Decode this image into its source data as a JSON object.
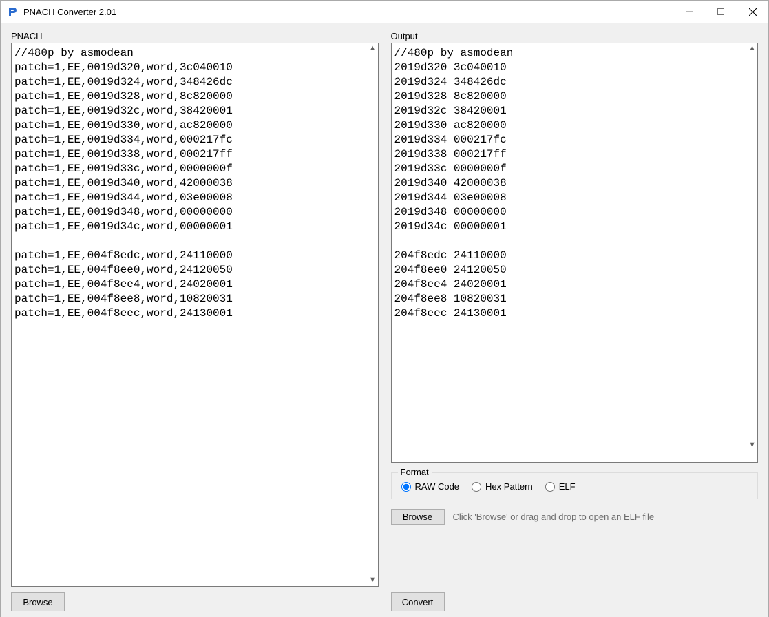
{
  "window": {
    "title": "PNACH Converter 2.01"
  },
  "labels": {
    "pnach": "PNACH",
    "output": "Output",
    "format_legend": "Format"
  },
  "radios": {
    "raw": "RAW Code",
    "hex": "Hex Pattern",
    "elf": "ELF"
  },
  "buttons": {
    "browse": "Browse",
    "convert": "Convert"
  },
  "hint": {
    "elf": "Click 'Browse' or drag and drop to open an ELF file"
  },
  "input_text": "//480p by asmodean\npatch=1,EE,0019d320,word,3c040010\npatch=1,EE,0019d324,word,348426dc\npatch=1,EE,0019d328,word,8c820000\npatch=1,EE,0019d32c,word,38420001\npatch=1,EE,0019d330,word,ac820000\npatch=1,EE,0019d334,word,000217fc\npatch=1,EE,0019d338,word,000217ff\npatch=1,EE,0019d33c,word,0000000f\npatch=1,EE,0019d340,word,42000038\npatch=1,EE,0019d344,word,03e00008\npatch=1,EE,0019d348,word,00000000\npatch=1,EE,0019d34c,word,00000001\n\npatch=1,EE,004f8edc,word,24110000\npatch=1,EE,004f8ee0,word,24120050\npatch=1,EE,004f8ee4,word,24020001\npatch=1,EE,004f8ee8,word,10820031\npatch=1,EE,004f8eec,word,24130001",
  "output_text": "//480p by asmodean\n2019d320 3c040010\n2019d324 348426dc\n2019d328 8c820000\n2019d32c 38420001\n2019d330 ac820000\n2019d334 000217fc\n2019d338 000217ff\n2019d33c 0000000f\n2019d340 42000038\n2019d344 03e00008\n2019d348 00000000\n2019d34c 00000001\n\n204f8edc 24110000\n204f8ee0 24120050\n204f8ee4 24020001\n204f8ee8 10820031\n204f8eec 24130001"
}
